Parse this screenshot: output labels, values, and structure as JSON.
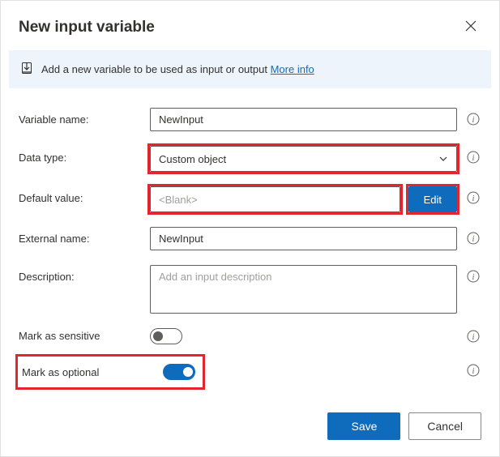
{
  "header": {
    "title": "New input variable"
  },
  "banner": {
    "text": "Add a new variable to be used as input or output",
    "link": "More info"
  },
  "labels": {
    "variable_name": "Variable name:",
    "data_type": "Data type:",
    "default_value": "Default value:",
    "external_name": "External name:",
    "description": "Description:",
    "mark_sensitive": "Mark as sensitive",
    "mark_optional": "Mark as optional"
  },
  "values": {
    "variable_name": "NewInput",
    "data_type": "Custom object",
    "default_value": "<Blank>",
    "external_name": "NewInput",
    "description": "",
    "description_placeholder": "Add an input description",
    "mark_sensitive": false,
    "mark_optional": true
  },
  "buttons": {
    "edit": "Edit",
    "save": "Save",
    "cancel": "Cancel"
  }
}
